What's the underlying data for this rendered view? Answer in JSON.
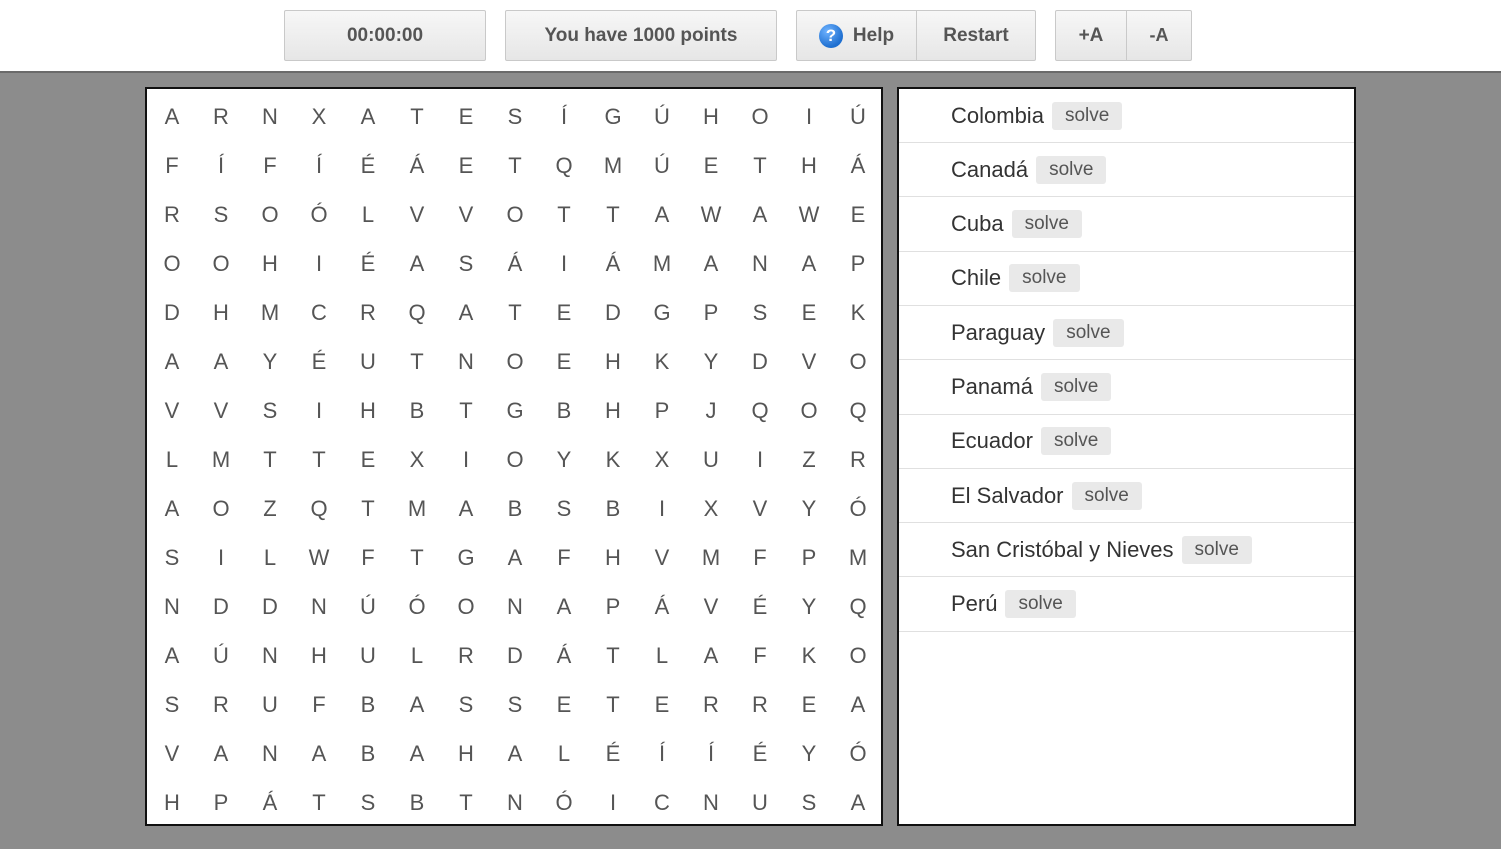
{
  "toolbar": {
    "timer": "00:00:00",
    "points": "You have 1000 points",
    "help_label": "Help",
    "help_icon": "?",
    "restart_label": "Restart",
    "font_increase_label": "+A",
    "font_decrease_label": "-A"
  },
  "grid": {
    "rows": [
      [
        "A",
        "R",
        "N",
        "X",
        "A",
        "T",
        "E",
        "S",
        "Í",
        "G",
        "Ú",
        "H",
        "O",
        "I",
        "Ú"
      ],
      [
        "F",
        "Í",
        "F",
        "Í",
        "É",
        "Á",
        "E",
        "T",
        "Q",
        "M",
        "Ú",
        "E",
        "T",
        "H",
        "Á"
      ],
      [
        "R",
        "S",
        "O",
        "Ó",
        "L",
        "V",
        "V",
        "O",
        "T",
        "T",
        "A",
        "W",
        "A",
        "W",
        "E"
      ],
      [
        "O",
        "O",
        "H",
        "I",
        "É",
        "A",
        "S",
        "Á",
        "I",
        "Á",
        "M",
        "A",
        "N",
        "A",
        "P"
      ],
      [
        "D",
        "H",
        "M",
        "C",
        "R",
        "Q",
        "A",
        "T",
        "E",
        "D",
        "G",
        "P",
        "S",
        "E",
        "K"
      ],
      [
        "A",
        "A",
        "Y",
        "É",
        "U",
        "T",
        "N",
        "O",
        "E",
        "H",
        "K",
        "Y",
        "D",
        "V",
        "O"
      ],
      [
        "V",
        "V",
        "S",
        "I",
        "H",
        "B",
        "T",
        "G",
        "B",
        "H",
        "P",
        "J",
        "Q",
        "O",
        "Q"
      ],
      [
        "L",
        "M",
        "T",
        "T",
        "E",
        "X",
        "I",
        "O",
        "Y",
        "K",
        "X",
        "U",
        "I",
        "Z",
        "R"
      ],
      [
        "A",
        "O",
        "Z",
        "Q",
        "T",
        "M",
        "A",
        "B",
        "S",
        "B",
        "I",
        "X",
        "V",
        "Y",
        "Ó"
      ],
      [
        "S",
        "I",
        "L",
        "W",
        "F",
        "T",
        "G",
        "A",
        "F",
        "H",
        "V",
        "M",
        "F",
        "P",
        "M"
      ],
      [
        "N",
        "D",
        "D",
        "N",
        "Ú",
        "Ó",
        "O",
        "N",
        "A",
        "P",
        "Á",
        "V",
        "É",
        "Y",
        "Q"
      ],
      [
        "A",
        "Ú",
        "N",
        "H",
        "U",
        "L",
        "R",
        "D",
        "Á",
        "T",
        "L",
        "A",
        "F",
        "K",
        "O"
      ],
      [
        "S",
        "R",
        "U",
        "F",
        "B",
        "A",
        "S",
        "S",
        "E",
        "T",
        "E",
        "R",
        "R",
        "E",
        "A"
      ],
      [
        "V",
        "A",
        "N",
        "A",
        "B",
        "A",
        "H",
        "A",
        "L",
        "É",
        "Í",
        "Í",
        "É",
        "Y",
        "Ó"
      ],
      [
        "H",
        "P",
        "Á",
        "T",
        "S",
        "B",
        "T",
        "N",
        "Ó",
        "I",
        "C",
        "N",
        "U",
        "S",
        "A"
      ]
    ]
  },
  "words": [
    {
      "name": "Colombia",
      "action": "solve"
    },
    {
      "name": "Canadá",
      "action": "solve"
    },
    {
      "name": "Cuba",
      "action": "solve"
    },
    {
      "name": "Chile",
      "action": "solve"
    },
    {
      "name": "Paraguay",
      "action": "solve"
    },
    {
      "name": "Panamá",
      "action": "solve"
    },
    {
      "name": "Ecuador",
      "action": "solve"
    },
    {
      "name": "El Salvador",
      "action": "solve"
    },
    {
      "name": "San Cristóbal y Nieves",
      "action": "solve"
    },
    {
      "name": "Perú",
      "action": "solve"
    }
  ]
}
